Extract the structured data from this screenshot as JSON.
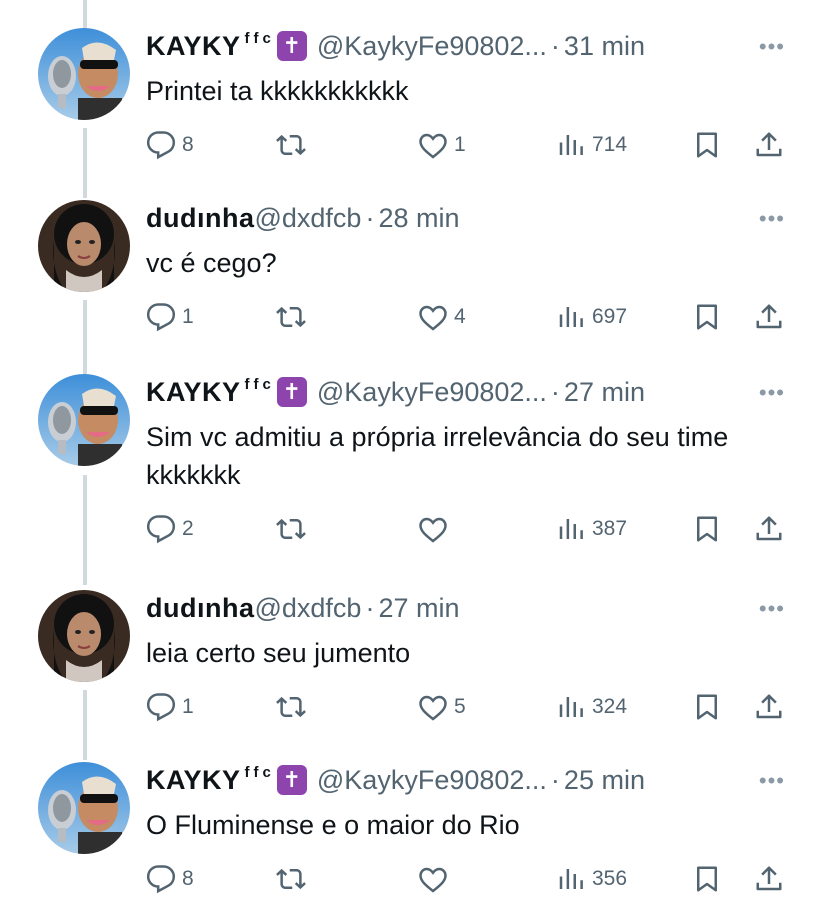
{
  "tweets": [
    {
      "name": "KAYKY",
      "name_suffix": "ffc",
      "badge": "✝",
      "handle": "@KaykyFe90802...",
      "time": "31 min",
      "text": "Printei ta kkkkkkkkkkk",
      "replies": "8",
      "retweets": "",
      "likes": "1",
      "views": "714",
      "avatar": "kayky"
    },
    {
      "name": "dudınha",
      "name_suffix": "",
      "badge": "",
      "handle": "@dxdfcb",
      "time": "28 min",
      "text": "vc é cego?",
      "replies": "1",
      "retweets": "",
      "likes": "4",
      "views": "697",
      "avatar": "dudinha"
    },
    {
      "name": "KAYKY",
      "name_suffix": "ffc",
      "badge": "✝",
      "handle": "@KaykyFe90802...",
      "time": "27 min",
      "text": "Sim vc admitiu a própria irrelevância do seu time kkkkkkk",
      "replies": "2",
      "retweets": "",
      "likes": "",
      "views": "387",
      "avatar": "kayky"
    },
    {
      "name": "dudınha",
      "name_suffix": "",
      "badge": "",
      "handle": "@dxdfcb",
      "time": "27 min",
      "text": "leia certo seu jumento",
      "replies": "1",
      "retweets": "",
      "likes": "5",
      "views": "324",
      "avatar": "dudinha"
    },
    {
      "name": "KAYKY",
      "name_suffix": "ffc",
      "badge": "✝",
      "handle": "@KaykyFe90802...",
      "time": "25 min",
      "text": "O Fluminense e o maior do Rio",
      "replies": "8",
      "retweets": "",
      "likes": "",
      "views": "356",
      "avatar": "kayky"
    }
  ],
  "ui": {
    "dot": "·",
    "more": "•••"
  },
  "colors": {
    "text": "#0f1419",
    "secondary": "#536471",
    "thread_line": "#cfd9de",
    "badge": "#8e44ad"
  },
  "icons": [
    "reply-icon",
    "retweet-icon",
    "like-icon",
    "views-icon",
    "bookmark-icon",
    "share-icon",
    "more-icon"
  ]
}
